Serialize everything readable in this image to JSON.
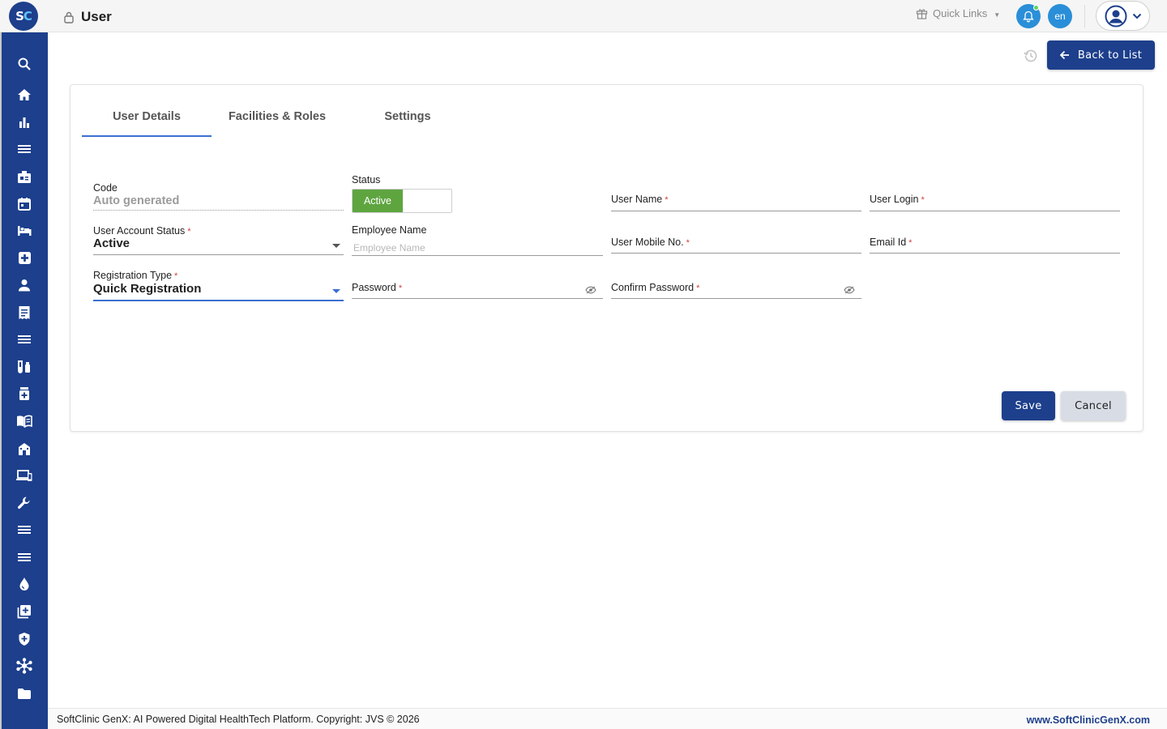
{
  "app": {
    "logo_letters": [
      "S",
      "C"
    ],
    "page_title": "User"
  },
  "header": {
    "quick_links_label": "Quick Links",
    "language": "en"
  },
  "sidebar": {
    "icons": [
      "search-icon",
      "home-icon",
      "bar-chart-icon",
      "menu-lines-icon",
      "clinic-badge-icon",
      "calendar-icon",
      "bed-icon",
      "medical-plus-icon",
      "person-icon",
      "receipt-icon",
      "menu-lines-icon",
      "lab-tubes-icon",
      "pharmacy-bottle-icon",
      "open-book-icon",
      "building-icon",
      "devices-icon",
      "wrench-icon",
      "menu-lines-icon",
      "menu-lines-icon",
      "blood-drop-icon",
      "add-document-icon",
      "shield-icon",
      "network-icon",
      "folder-icon"
    ]
  },
  "actions": {
    "back_label": "Back to List"
  },
  "tabs": [
    {
      "label": "User Details",
      "active": true
    },
    {
      "label": "Facilities & Roles",
      "active": false
    },
    {
      "label": "Settings",
      "active": false
    }
  ],
  "form": {
    "code": {
      "label": "Code",
      "value": "Auto generated"
    },
    "status": {
      "label": "Status",
      "value": "Active"
    },
    "user_name": {
      "label": "User Name",
      "required": "*",
      "value": ""
    },
    "user_login": {
      "label": "User Login",
      "required": "*",
      "value": ""
    },
    "account_status": {
      "label": "User Account Status",
      "required": "*",
      "value": "Active"
    },
    "employee_name": {
      "label": "Employee Name",
      "placeholder": "Employee Name",
      "value": ""
    },
    "mobile": {
      "label": "User Mobile No.",
      "required": "*",
      "value": ""
    },
    "email": {
      "label": "Email Id",
      "required": "*",
      "value": ""
    },
    "registration_type": {
      "label": "Registration Type",
      "required": "*",
      "value": "Quick Registration"
    },
    "password": {
      "label": "Password",
      "required": "*",
      "value": ""
    },
    "confirm_password": {
      "label": "Confirm Password",
      "required": "*",
      "value": ""
    }
  },
  "buttons": {
    "save": "Save",
    "cancel": "Cancel"
  },
  "footer": {
    "copyright": "SoftClinic GenX: AI Powered Digital HealthTech Platform. Copyright: JVS © 2026",
    "website": "www.SoftClinicGenX.com"
  },
  "colors": {
    "primary": "#1d3f8c",
    "accent": "#3b6fd1",
    "status_active": "#5ea540",
    "notification_blue": "#2a8fd8",
    "required": "#d24040"
  }
}
